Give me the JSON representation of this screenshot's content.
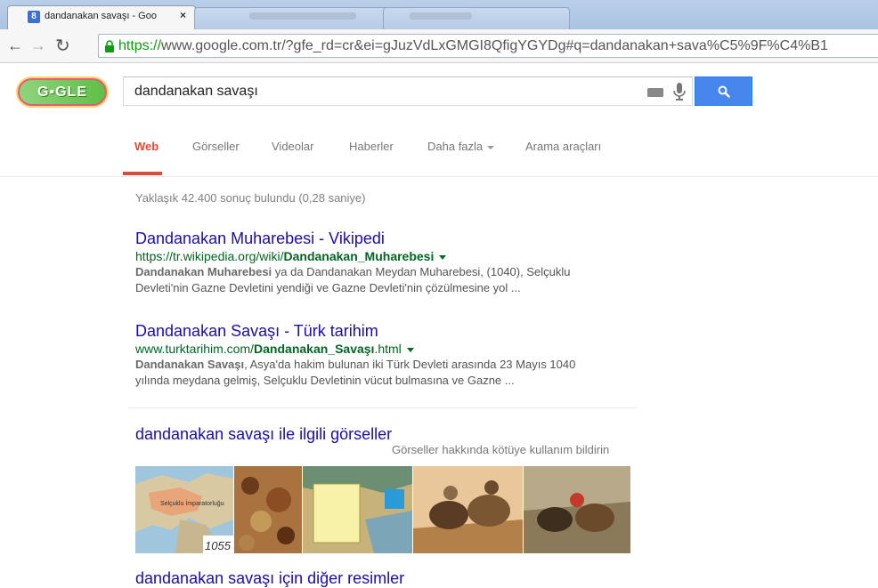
{
  "browser": {
    "tab_title": "dandanakan savaşı - Goo",
    "tab_close": "×",
    "url_scheme": "https://",
    "url_rest": "www.google.com.tr/?gfe_rd=cr&ei=gJuzVdLxGMGI8QfigYGYDg#q=dandanakan+sava%C5%9F%C4%B1"
  },
  "google": {
    "doodle_text": "G▪GLE",
    "search_query": "dandanakan savaşı",
    "tabs": [
      "Web",
      "Görseller",
      "Videolar",
      "Haberler",
      "Daha fazla",
      "Arama araçları"
    ]
  },
  "results": {
    "stats": "Yaklaşık 42.400 sonuç bulundu (0,28 saniye)",
    "items": [
      {
        "title": "Dandanakan Muharebesi - Vikipedi",
        "url_prefix": "https://tr.wikipedia.org/wiki/",
        "url_bold": "Dandanakan_Muharebesi",
        "url_suffix": "",
        "snippet_bold": "Dandanakan Muharebesi",
        "snippet_line1": " ya da Dandanakan Meydan Muharebesi, (1040), Selçuklu",
        "snippet_line2": "Devleti'nin Gazne Devletini yendiği ve Gazne Devleti'nin çözülmesine yol ..."
      },
      {
        "title": "Dandanakan Savaşı - Türk tarihim",
        "url_prefix": "www.turktarihim.com/",
        "url_bold": "Dandanakan_Savaşı",
        "url_suffix": ".html",
        "snippet_bold": "Dandanakan Savaşı",
        "snippet_line1": ", Asya'da hakim bulunan iki Türk Devleti arasında 23 Mayıs 1040",
        "snippet_line2": "yılında meydana gelmiş, Selçuklu Devletinin vücut bulmasına ve Gazne ..."
      }
    ],
    "images_title": "dandanakan savaşı ile ilgili görseller",
    "images_report": "Görseller hakkında kötüye kullanım bildirin",
    "thumb_labels": [
      "Selçuklu İmparatorluğu",
      "1055"
    ],
    "more_images": "dandanakan savaşı için diğer resimler"
  },
  "colors": {
    "link": "#1a0dab",
    "url_green": "#006621",
    "active_tab_red": "#dd4b39",
    "search_blue": "#4787ed"
  }
}
